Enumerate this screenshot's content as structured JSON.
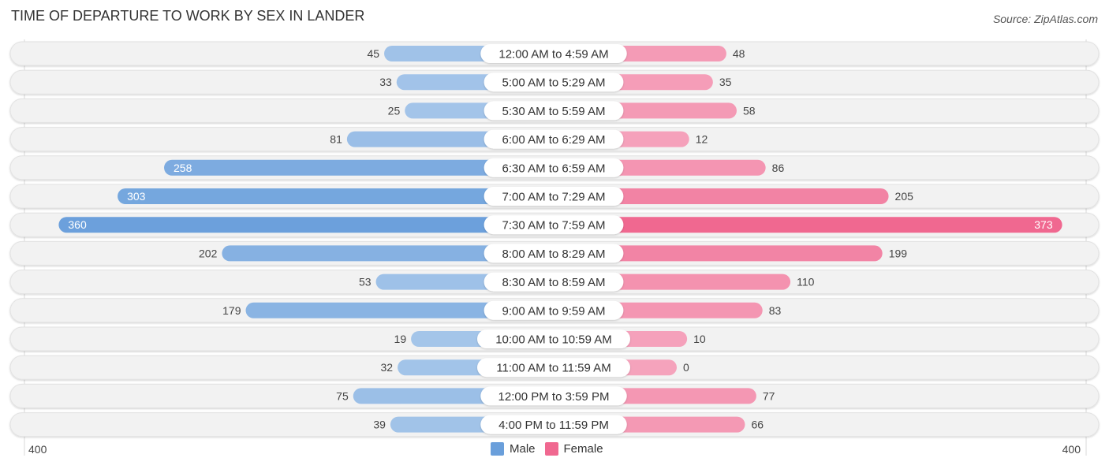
{
  "title": "TIME OF DEPARTURE TO WORK BY SEX IN LANDER",
  "source": "Source: ZipAtlas.com",
  "colors": {
    "male_light": "#a7c7ea",
    "male_dark": "#6a9fdb",
    "female_light": "#f5a3bc",
    "female_dark": "#f06890",
    "track": "#f2f2f2"
  },
  "legend": [
    {
      "label": "Male",
      "color": "#6a9fdb"
    },
    {
      "label": "Female",
      "color": "#f06890"
    }
  ],
  "axis": {
    "left_label": "400",
    "right_label": "400"
  },
  "chart_data": {
    "type": "bar",
    "orientation": "horizontal-diverging",
    "title": "TIME OF DEPARTURE TO WORK BY SEX IN LANDER",
    "categories": [
      "12:00 AM to 4:59 AM",
      "5:00 AM to 5:29 AM",
      "5:30 AM to 5:59 AM",
      "6:00 AM to 6:29 AM",
      "6:30 AM to 6:59 AM",
      "7:00 AM to 7:29 AM",
      "7:30 AM to 7:59 AM",
      "8:00 AM to 8:29 AM",
      "8:30 AM to 8:59 AM",
      "9:00 AM to 9:59 AM",
      "10:00 AM to 10:59 AM",
      "11:00 AM to 11:59 AM",
      "12:00 PM to 3:59 PM",
      "4:00 PM to 11:59 PM"
    ],
    "series": [
      {
        "name": "Male",
        "values": [
          45,
          33,
          25,
          81,
          258,
          303,
          360,
          202,
          53,
          179,
          19,
          32,
          75,
          39
        ]
      },
      {
        "name": "Female",
        "values": [
          48,
          35,
          58,
          12,
          86,
          205,
          373,
          199,
          110,
          83,
          10,
          0,
          77,
          66
        ]
      }
    ],
    "xlim": [
      -400,
      400
    ],
    "legend_position": "bottom-center",
    "grid": false
  }
}
